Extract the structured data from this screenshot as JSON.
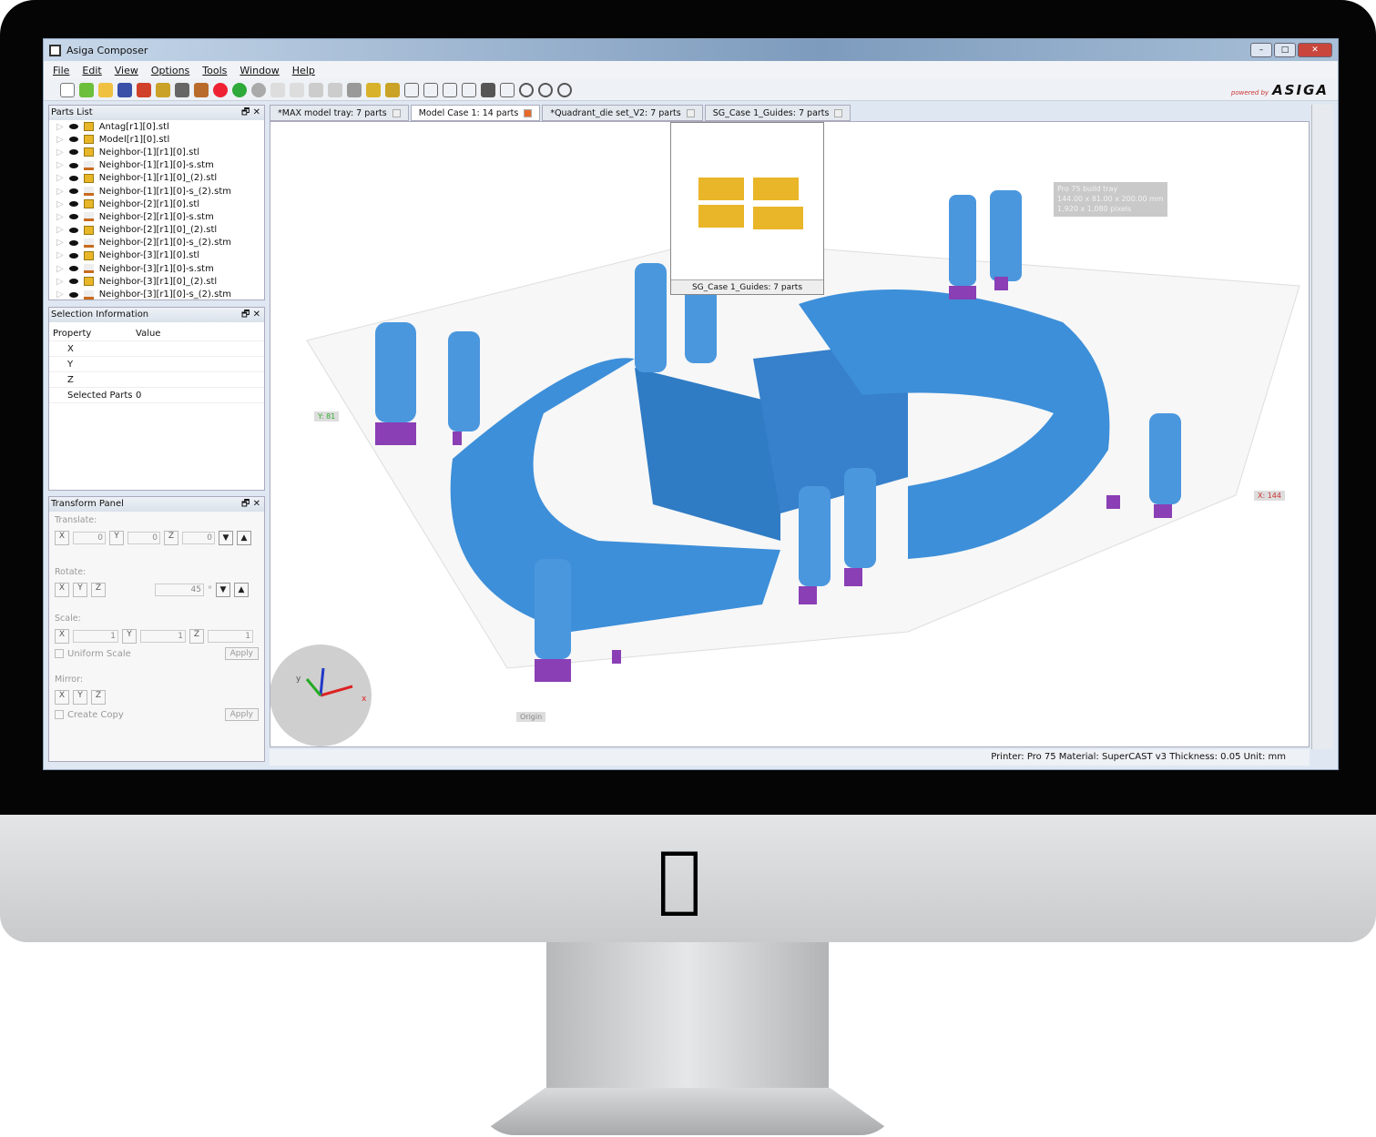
{
  "window": {
    "title": "Asiga Composer",
    "brand_prefix": "powered by",
    "brand": "ASIGA"
  },
  "menu": [
    "File",
    "Edit",
    "View",
    "Options",
    "Tools",
    "Window",
    "Help"
  ],
  "parts_list": {
    "title": "Parts List",
    "items": [
      "Antag[r1][0].stl",
      "Model[r1][0].stl",
      "Neighbor-[1][r1][0].stl",
      "Neighbor-[1][r1][0]-s.stm",
      "Neighbor-[1][r1][0]_(2).stl",
      "Neighbor-[1][r1][0]-s_(2).stm",
      "Neighbor-[2][r1][0].stl",
      "Neighbor-[2][r1][0]-s.stm",
      "Neighbor-[2][r1][0]_(2).stl",
      "Neighbor-[2][r1][0]-s_(2).stm",
      "Neighbor-[3][r1][0].stl",
      "Neighbor-[3][r1][0]-s.stm",
      "Neighbor-[3][r1][0]_(2).stl",
      "Neighbor-[3][r1][0]-s_(2).stm"
    ]
  },
  "selection": {
    "title": "Selection Information",
    "col_property": "Property",
    "col_value": "Value",
    "rows": [
      {
        "p": "X",
        "v": ""
      },
      {
        "p": "Y",
        "v": ""
      },
      {
        "p": "Z",
        "v": ""
      },
      {
        "p": "Selected Parts",
        "v": "0"
      }
    ]
  },
  "transform": {
    "title": "Transform Panel",
    "translate": "Translate:",
    "tx": "0",
    "ty": "0",
    "tz": "0",
    "rotate": "Rotate:",
    "angle": "45",
    "deg": "°",
    "scale": "Scale:",
    "sx": "1",
    "sy": "1",
    "sz": "1",
    "uniform": "Uniform Scale",
    "apply": "Apply",
    "mirror": "Mirror:",
    "copy": "Create Copy"
  },
  "tabs": [
    {
      "label": "*MAX model tray: 7 parts"
    },
    {
      "label": "Model Case 1: 14 parts",
      "active": true
    },
    {
      "label": "*Quadrant_die set_V2: 7 parts"
    },
    {
      "label": "SG_Case 1_Guides: 7 parts"
    }
  ],
  "thumbnail_caption": "SG_Case 1_Guides: 7 parts",
  "viewport": {
    "info_lines": [
      "Pro 75 build tray",
      "144.00 x 81.00 x 200.00 mm",
      "1,920 x 1,080 pixels"
    ],
    "y_label": "Y: 81",
    "x_label": "X: 144",
    "origin_label": "Origin",
    "axis_x": "x",
    "axis_y": "y"
  },
  "status": "Printer: Pro 75  Material: SuperCAST v3  Thickness: 0.05  Unit: mm",
  "colors": {
    "model": "#3d8fd9",
    "supports": "#8a3fb5",
    "accent": "#e86a2a"
  }
}
